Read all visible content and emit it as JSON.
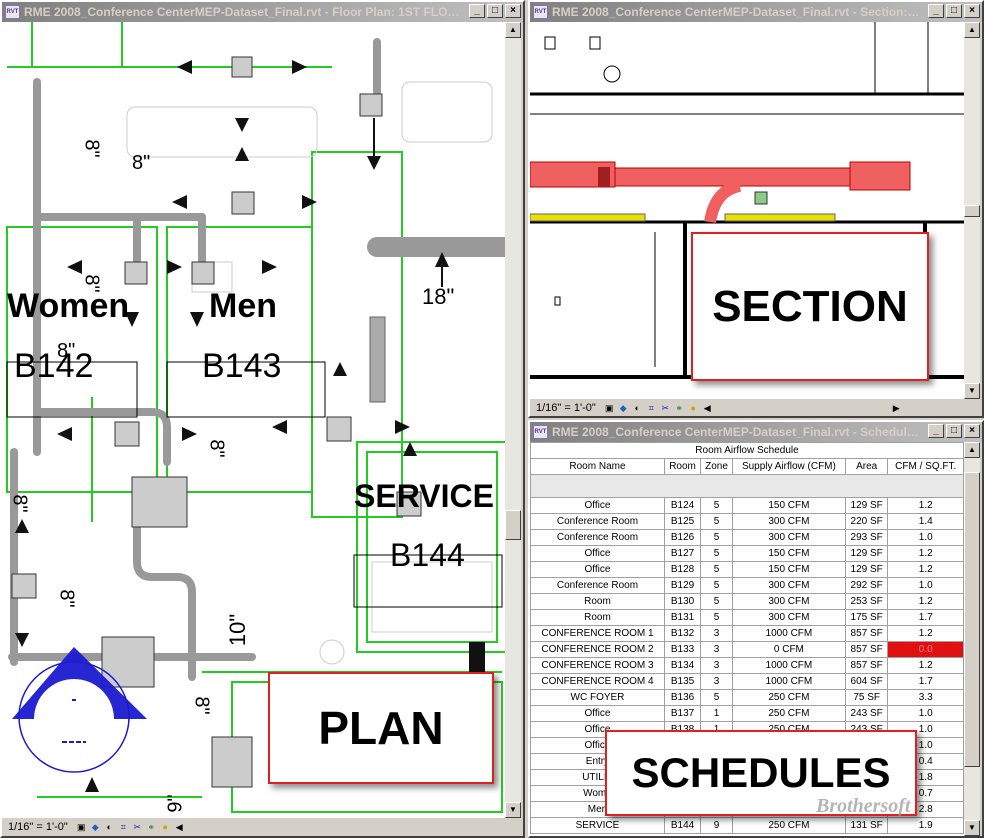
{
  "windows": {
    "plan": {
      "title": "RME 2008_Conference CenterMEP-Dataset_Final.rvt - Floor Plan: 1ST FLOOR-...",
      "scale": "1/16\" = 1'-0\"",
      "callout": "PLAN",
      "labels": {
        "women": "Women",
        "men": "Men",
        "service": "SERVICE",
        "b142": "B142",
        "b143": "B143",
        "b144": "B144",
        "dim8a": "8\"",
        "dim8b": "8\"",
        "dim8c": "8\"",
        "dim8d": "8\"",
        "dim8e": "8\"",
        "dim8f": "8\"",
        "dim8g": "8\"",
        "dim8h": "8\"",
        "dim18": "18\"",
        "dim10": "10\"",
        "dim9": "9\""
      }
    },
    "section": {
      "title": "RME 2008_Conference CenterMEP-Dataset_Final.rvt - Section: Se...",
      "scale": "1/16\" = 1'-0\"",
      "callout": "SECTION"
    },
    "schedule": {
      "title": "RME 2008_Conference CenterMEP-Dataset_Final.rvt - Schedule: ...",
      "table_title": "Room Airflow Schedule",
      "headers": [
        "Room Name",
        "Room",
        "Zone",
        "Supply Airflow (CFM)",
        "Area",
        "CFM / SQ.FT."
      ],
      "rows": [
        [
          "Office",
          "B124",
          "5",
          "150 CFM",
          "129 SF",
          "1.2"
        ],
        [
          "Conference Room",
          "B125",
          "5",
          "300 CFM",
          "220 SF",
          "1.4"
        ],
        [
          "Conference Room",
          "B126",
          "5",
          "300 CFM",
          "293 SF",
          "1.0"
        ],
        [
          "Office",
          "B127",
          "5",
          "150 CFM",
          "129 SF",
          "1.2"
        ],
        [
          "Office",
          "B128",
          "5",
          "150 CFM",
          "129 SF",
          "1.2"
        ],
        [
          "Conference Room",
          "B129",
          "5",
          "300 CFM",
          "292 SF",
          "1.0"
        ],
        [
          "Room",
          "B130",
          "5",
          "300 CFM",
          "253 SF",
          "1.2"
        ],
        [
          "Room",
          "B131",
          "5",
          "300 CFM",
          "175 SF",
          "1.7"
        ],
        [
          "CONFERENCE ROOM 1",
          "B132",
          "3",
          "1000 CFM",
          "857 SF",
          "1.2"
        ],
        [
          "CONFERENCE ROOM 2",
          "B133",
          "3",
          "0 CFM",
          "857 SF",
          "0.0"
        ],
        [
          "CONFERENCE ROOM 3",
          "B134",
          "3",
          "1000 CFM",
          "857 SF",
          "1.2"
        ],
        [
          "CONFERENCE ROOM 4",
          "B135",
          "3",
          "1000 CFM",
          "604 SF",
          "1.7"
        ],
        [
          "WC FOYER",
          "B136",
          "5",
          "250 CFM",
          "75 SF",
          "3.3"
        ],
        [
          "Office",
          "B137",
          "1",
          "250 CFM",
          "243 SF",
          "1.0"
        ],
        [
          "Office",
          "B138",
          "1",
          "250 CFM",
          "243 SF",
          "1.0"
        ],
        [
          "Office",
          "",
          "",
          "",
          "",
          "1.0"
        ],
        [
          "Entry",
          "",
          "",
          "",
          "",
          "0.4"
        ],
        [
          "UTILIT",
          "",
          "",
          "",
          "",
          "1.8"
        ],
        [
          "Wome",
          "",
          "",
          "",
          "",
          "0.7"
        ],
        [
          "Men",
          "",
          "",
          "",
          "",
          "2.8"
        ],
        [
          "SERVICE",
          "B144",
          "9",
          "250 CFM",
          "131 SF",
          "1.9"
        ]
      ],
      "callout": "SCHEDULES"
    }
  },
  "watermark": "Brothersoft",
  "colors": {
    "title_active": "#0a246a",
    "callout_border": "#e02020",
    "duct_red": "#f05050",
    "room_green": "#22cc22",
    "alert_red": "#e01010"
  }
}
